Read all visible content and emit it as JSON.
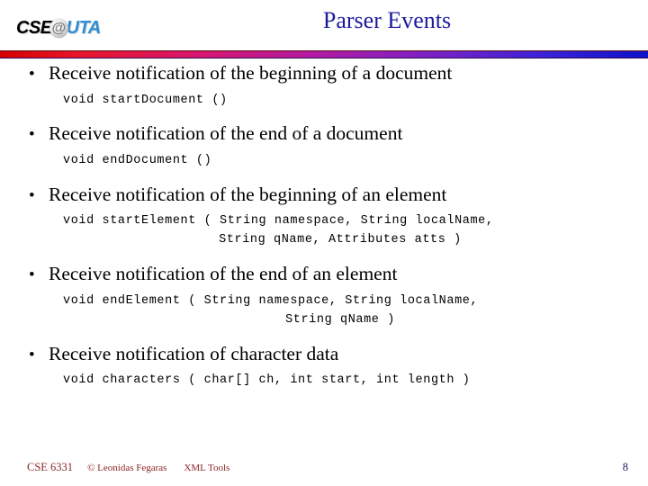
{
  "header": {
    "logo": {
      "prefix": "CSE",
      "at_symbol": "@",
      "suffix": "UTA",
      "prefix_color": "#000000",
      "suffix_color": "#2c8ed6"
    },
    "title": "Parser Events",
    "title_color": "#1b1b9e",
    "divider": {
      "start_color": "#d40000",
      "end_color": "#0d12c9"
    }
  },
  "body": {
    "bullet_char": "•",
    "bullets": [
      {
        "text": "Receive notification of the beginning of a document",
        "code": [
          "void startDocument ()"
        ]
      },
      {
        "text": "Receive notification of the end of a document",
        "code": [
          "void endDocument ()"
        ]
      },
      {
        "text": "Receive notification of the beginning of an element",
        "code": [
          "void startElement ( String namespace, String localName,",
          "String qName, Attributes atts )"
        ]
      },
      {
        "text": "Receive notification of the end of an element",
        "code": [
          "void endElement ( String namespace, String localName,",
          "String qName )"
        ]
      },
      {
        "text": "Receive notification of character data",
        "code": [
          "void characters ( char[] ch, int start, int length )"
        ]
      }
    ]
  },
  "footer": {
    "course": "CSE 6331",
    "copyright": "© Leonidas Fegaras",
    "topic": "XML Tools",
    "page_number": "8",
    "text_color": "#8c2424",
    "page_color": "#1b1b5e"
  }
}
